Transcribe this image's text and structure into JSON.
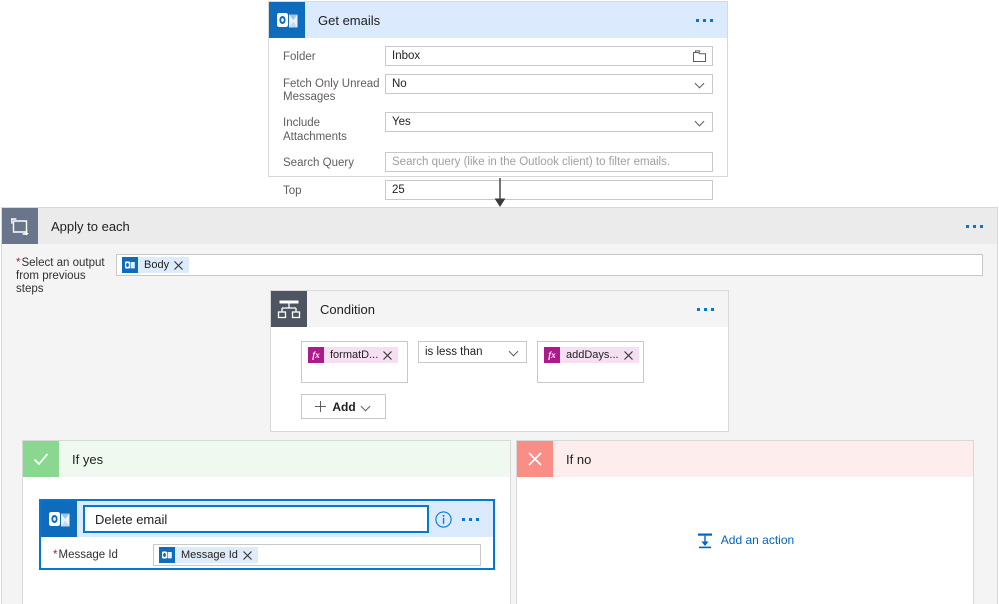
{
  "flow": {
    "get_emails": {
      "title": "Get emails",
      "icon": "outlook-icon",
      "menu_icon": "ellipsis-icon",
      "header_bg": "#dbeafc",
      "fields": [
        {
          "label": "Folder",
          "value": "Inbox",
          "control": "picker",
          "trailing_icon": "folder-icon"
        },
        {
          "label": "Fetch Only Unread Messages",
          "value": "No",
          "control": "dropdown",
          "trailing_icon": "chevron-down-icon"
        },
        {
          "label": "Include Attachments",
          "value": "Yes",
          "control": "dropdown",
          "trailing_icon": "chevron-down-icon"
        },
        {
          "label": "Search Query",
          "value": "",
          "placeholder": "Search query (like in the Outlook client) to filter emails.",
          "control": "text"
        },
        {
          "label": "Top",
          "value": "25",
          "control": "text"
        }
      ]
    },
    "connector": {
      "icon": "down-arrow-icon"
    },
    "apply_to_each": {
      "title": "Apply to each",
      "icon": "loop-icon",
      "menu_icon": "ellipsis-icon",
      "select_output": {
        "label_line1": "Select an output",
        "label_line2": "from previous steps",
        "required": true,
        "token": {
          "label": "Body",
          "icon": "outlook-icon",
          "remove_icon": "close-icon"
        }
      }
    },
    "condition": {
      "title": "Condition",
      "icon": "condition-icon",
      "menu_icon": "ellipsis-icon",
      "left_operand": {
        "label": "formatD...",
        "icon": "fx-icon",
        "remove_icon": "close-icon"
      },
      "operator": {
        "value": "is less than",
        "trailing_icon": "chevron-down-icon"
      },
      "right_operand": {
        "label": "addDays...",
        "icon": "fx-icon",
        "remove_icon": "close-icon"
      },
      "add_button": {
        "label": "Add",
        "leading_icon": "plus-icon",
        "trailing_icon": "chevron-down-icon"
      }
    },
    "if_yes": {
      "title": "If yes",
      "badge_icon": "checkmark-icon",
      "badge_color": "#8ad88f",
      "header_bg": "#eff9f0",
      "action": {
        "title": "Delete email",
        "icon": "outlook-icon",
        "info_icon": "info-icon",
        "menu_icon": "ellipsis-icon",
        "selected": true,
        "field": {
          "label": "Message Id",
          "required": true,
          "token": {
            "label": "Message Id",
            "icon": "outlook-icon",
            "remove_icon": "close-icon"
          }
        }
      }
    },
    "if_no": {
      "title": "If no",
      "badge_icon": "close-icon",
      "badge_color": "#f88e86",
      "header_bg": "#fdeeed",
      "add_action": {
        "label": "Add an action",
        "icon": "add-action-icon",
        "color": "#0263c2"
      }
    }
  }
}
